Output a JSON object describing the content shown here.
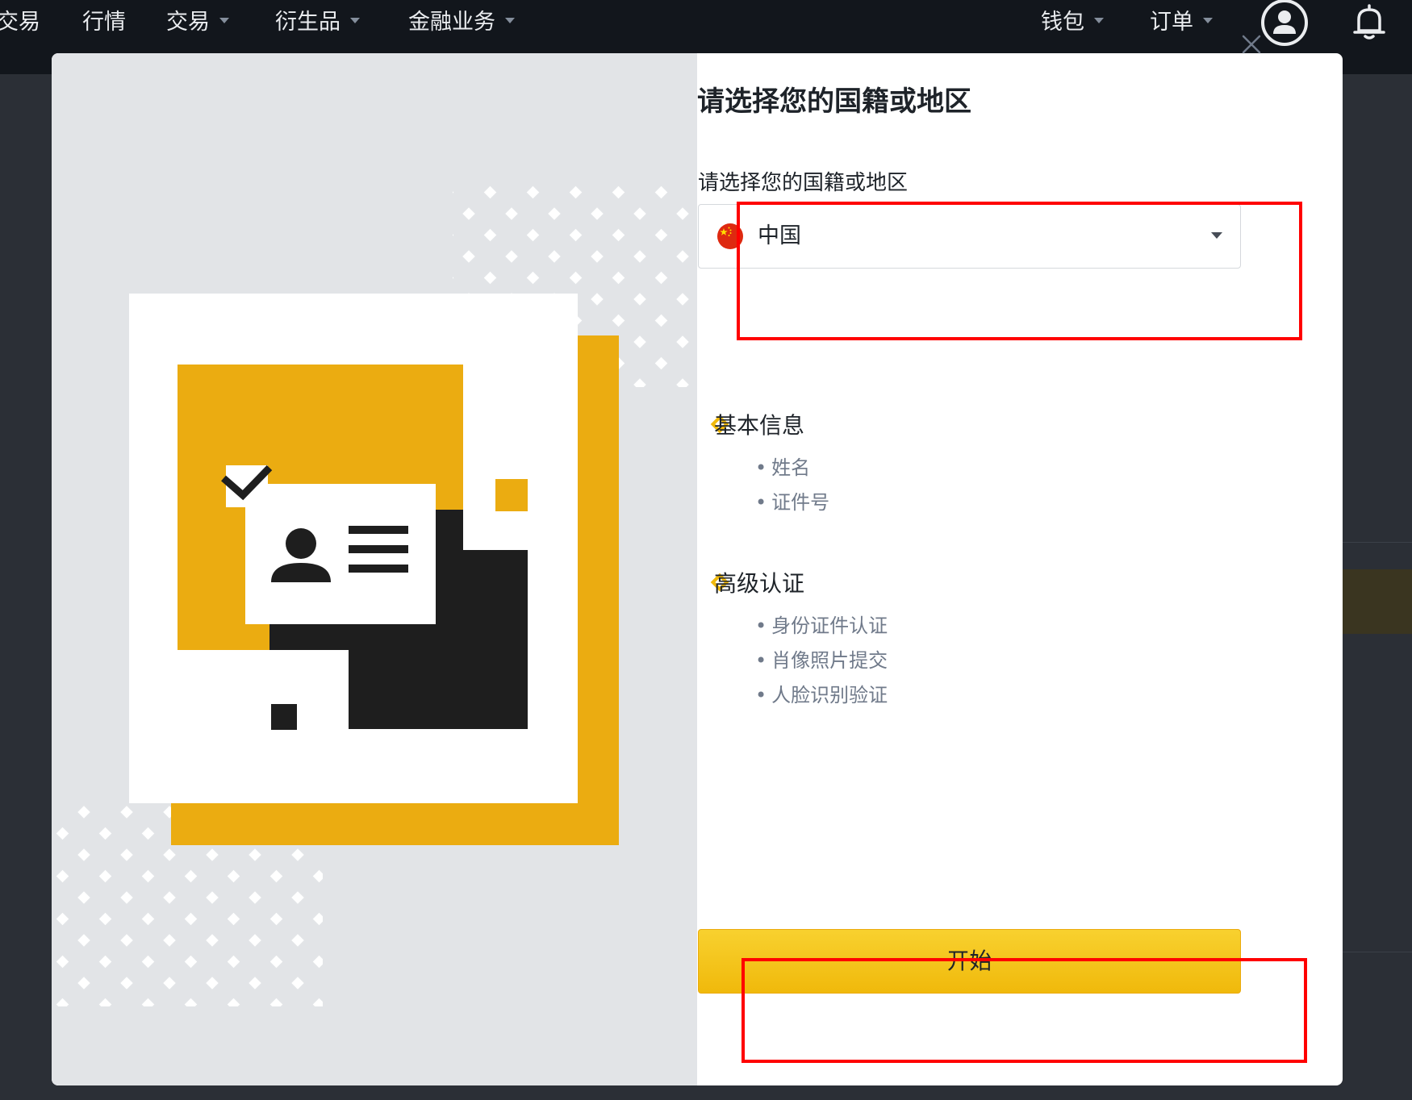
{
  "nav": {
    "left": [
      {
        "label": "交易",
        "dropdown": false
      },
      {
        "label": "行情",
        "dropdown": false
      },
      {
        "label": "交易",
        "dropdown": true
      },
      {
        "label": "衍生品",
        "dropdown": true
      },
      {
        "label": "金融业务",
        "dropdown": true
      }
    ],
    "right": [
      {
        "label": "钱包",
        "dropdown": true
      },
      {
        "label": "订单",
        "dropdown": true
      }
    ],
    "icons": [
      "user-icon",
      "bell-icon"
    ]
  },
  "modal": {
    "title": "请选择您的国籍或地区",
    "field_label": "请选择您的国籍或地区",
    "country": {
      "value": "中国",
      "flag": "china-flag-icon"
    },
    "sections": [
      {
        "title": "基本信息",
        "items": [
          "姓名",
          "证件号"
        ]
      },
      {
        "title": "高级认证",
        "items": [
          "身份证件认证",
          "肖像照片提交",
          "人脸识别验证"
        ]
      }
    ],
    "start_label": "开始",
    "close_icon": "close-icon"
  },
  "colors": {
    "accent": "#F0B90B",
    "nav_bg": "#12161C",
    "left_panel_bg": "#E2E4E7",
    "highlight": "#FF0000"
  }
}
